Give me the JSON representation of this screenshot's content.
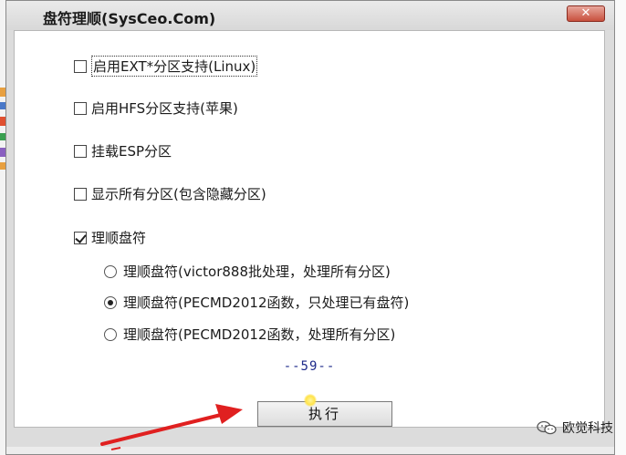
{
  "window": {
    "title": "盘符理顺(SysCeo.Com)",
    "close_symbol": "✕"
  },
  "options": {
    "ext": {
      "label": "启用EXT*分区支持(Linux)",
      "checked": false
    },
    "hfs": {
      "label": "启用HFS分区支持(苹果)",
      "checked": false
    },
    "esp": {
      "label": "挂载ESP分区",
      "checked": false
    },
    "show_all": {
      "label": "显示所有分区(包含隐藏分区)",
      "checked": false
    },
    "reorder": {
      "label": "理顺盘符",
      "checked": true
    }
  },
  "reorder_modes": [
    {
      "label": "理顺盘符(victor888批处理，处理所有分区)",
      "selected": false
    },
    {
      "label": "理顺盘符(PECMD2012函数，只处理已有盘符)",
      "selected": true
    },
    {
      "label": "理顺盘符(PECMD2012函数，处理所有分区)",
      "selected": false
    }
  ],
  "countdown": "--59--",
  "execute_button": {
    "label": "执行"
  },
  "watermark": {
    "icon": "wechat-icon",
    "text": "欧觉科技"
  },
  "colors": {
    "countdown": "#1d2a8a",
    "arrow": "#e02020",
    "close_button": "#c8503d"
  }
}
